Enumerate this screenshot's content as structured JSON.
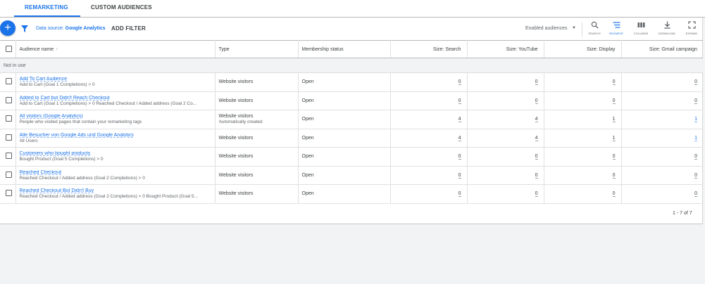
{
  "tabs": [
    {
      "label": "REMARKETING",
      "active": true
    },
    {
      "label": "CUSTOM AUDIENCES",
      "active": false
    }
  ],
  "toolbar": {
    "add_icon": "+",
    "data_source_prefix": "Data source:",
    "data_source_value": "Google Analytics",
    "add_filter": "ADD FILTER",
    "enabled_audiences": "Enabled audiences",
    "tools": [
      {
        "label": "SEARCH",
        "icon": "search-icon"
      },
      {
        "label": "SEGMENT",
        "icon": "segment-icon"
      },
      {
        "label": "COLUMNS",
        "icon": "columns-icon"
      },
      {
        "label": "DOWNLOAD",
        "icon": "download-icon"
      },
      {
        "label": "EXPAND",
        "icon": "expand-icon"
      }
    ]
  },
  "table": {
    "headers": {
      "name": "Audience name",
      "type": "Type",
      "membership": "Membership status",
      "search": "Size: Search",
      "youtube": "Size: YouTube",
      "display": "Size: Display",
      "gmail": "Size: Gmail campaign"
    },
    "section": "Not in use",
    "rows": [
      {
        "name": "Add To Cart Audience",
        "desc": "Add to Cart (Goal 1 Completions) > 0",
        "type": "Website visitors",
        "type2": "",
        "status": "Open",
        "search": "0",
        "youtube": "0",
        "display": "0",
        "gmail": "0"
      },
      {
        "name": "Added to Cart but Didn't Reach Checkout",
        "desc": "Add to Cart (Goal 1 Completions) > 0 Reached Checkout / Added address (Goal 2 Co...",
        "type": "Website visitors",
        "type2": "",
        "status": "Open",
        "search": "0",
        "youtube": "0",
        "display": "0",
        "gmail": "0"
      },
      {
        "name": "All visitors (Google Analytics)",
        "desc": "People who visited pages that contain your remarketing tags",
        "type": "Website visitors",
        "type2": "Automatically created",
        "status": "Open",
        "search": "4",
        "youtube": "4",
        "display": "1",
        "gmail": "1"
      },
      {
        "name": "Alle Besucher von Google Ads und Google Analytics",
        "desc": "All Users",
        "type": "Website visitors",
        "type2": "",
        "status": "Open",
        "search": "4",
        "youtube": "4",
        "display": "1",
        "gmail": "1"
      },
      {
        "name": "Customers who bought products",
        "desc": "Bought Product (Goal 5 Completions) > 0",
        "type": "Website visitors",
        "type2": "",
        "status": "Open",
        "search": "0",
        "youtube": "0",
        "display": "0",
        "gmail": "0"
      },
      {
        "name": "Reached Checkout",
        "desc": "Reached Checkout / Added address (Goal 2 Completions) > 0",
        "type": "Website visitors",
        "type2": "",
        "status": "Open",
        "search": "0",
        "youtube": "0",
        "display": "0",
        "gmail": "0"
      },
      {
        "name": "Reached Checkout But Didn't Buy",
        "desc": "Reached Checkout / Added address (Goal 2 Completions) > 0 Bought Product (Goal 5...",
        "type": "Website visitors",
        "type2": "",
        "status": "Open",
        "search": "0",
        "youtube": "0",
        "display": "0",
        "gmail": "0"
      }
    ],
    "pagination": "1 - 7 of 7"
  },
  "colors": {
    "accent": "#1a73e8",
    "text": "#3c4043",
    "muted": "#5f6368",
    "background": "#f1f3f4"
  }
}
